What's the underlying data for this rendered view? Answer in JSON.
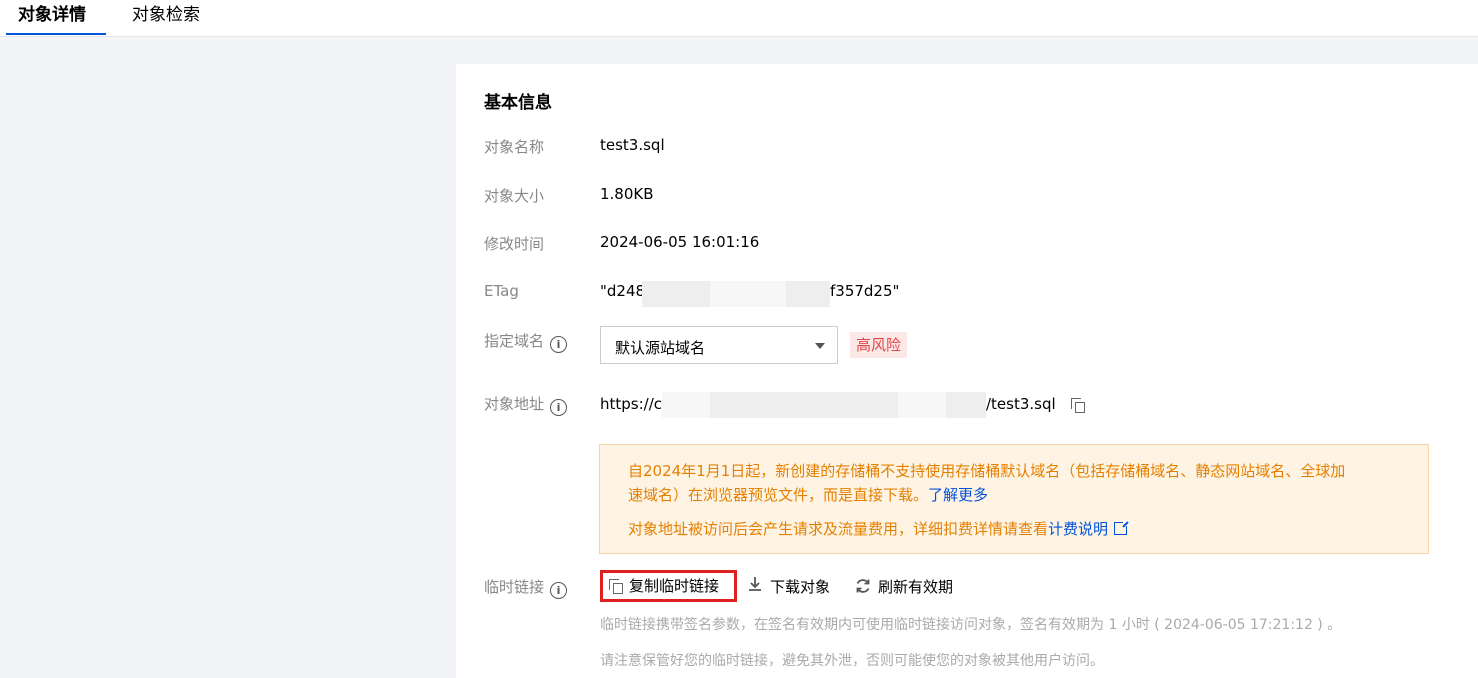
{
  "tabs": [
    {
      "label": "对象详情",
      "active": true
    },
    {
      "label": "对象检索",
      "active": false
    }
  ],
  "section_title": "基本信息",
  "fields": {
    "name": {
      "label": "对象名称",
      "value": "test3.sql"
    },
    "size": {
      "label": "对象大小",
      "value": "1.80KB"
    },
    "modified": {
      "label": "修改时间",
      "value": "2024-06-05 16:01:16"
    },
    "etag": {
      "label": "ETag",
      "prefix": "\"d248",
      "suffix": "f357d25\""
    },
    "domain": {
      "label": "指定域名",
      "selected": "默认源站域名",
      "risk_badge": "高风险"
    },
    "address": {
      "label": "对象地址",
      "prefix": "https://c",
      "suffix": "/test3.sql"
    },
    "temp_link": {
      "label": "临时链接"
    }
  },
  "notice": {
    "line1": "自2024年1月1日起，新创建的存储桶不支持使用存储桶默认域名（包括存储桶域名、静态网站域名、全球加",
    "line2": "速域名）在浏览器预览文件，而是直接下载。",
    "learn_more": "了解更多",
    "line3": "对象地址被访问后会产生请求及流量费用，详细扣费详情请查看",
    "billing_link": "计费说明"
  },
  "actions": {
    "copy_temp_link": "复制临时链接",
    "download": "下载对象",
    "refresh": "刷新有效期"
  },
  "help": {
    "line1": "临时链接携带签名参数，在签名有效期内可使用临时链接访问对象，签名有效期为 1 小时 ( 2024-06-05 17:21:12 ) 。",
    "line2": "请注意保管好您的临时链接，避免其外泄，否则可能使您的对象被其他用户访问。"
  },
  "colors": {
    "accent": "#0052d9",
    "warning_text": "#e57f00",
    "warning_bg": "#fff4e4",
    "risk_text": "#e54545",
    "highlight_border": "#e02020"
  },
  "icons": [
    "info-icon",
    "chevron-down-icon",
    "copy-icon",
    "external-link-icon",
    "download-icon",
    "refresh-icon"
  ]
}
